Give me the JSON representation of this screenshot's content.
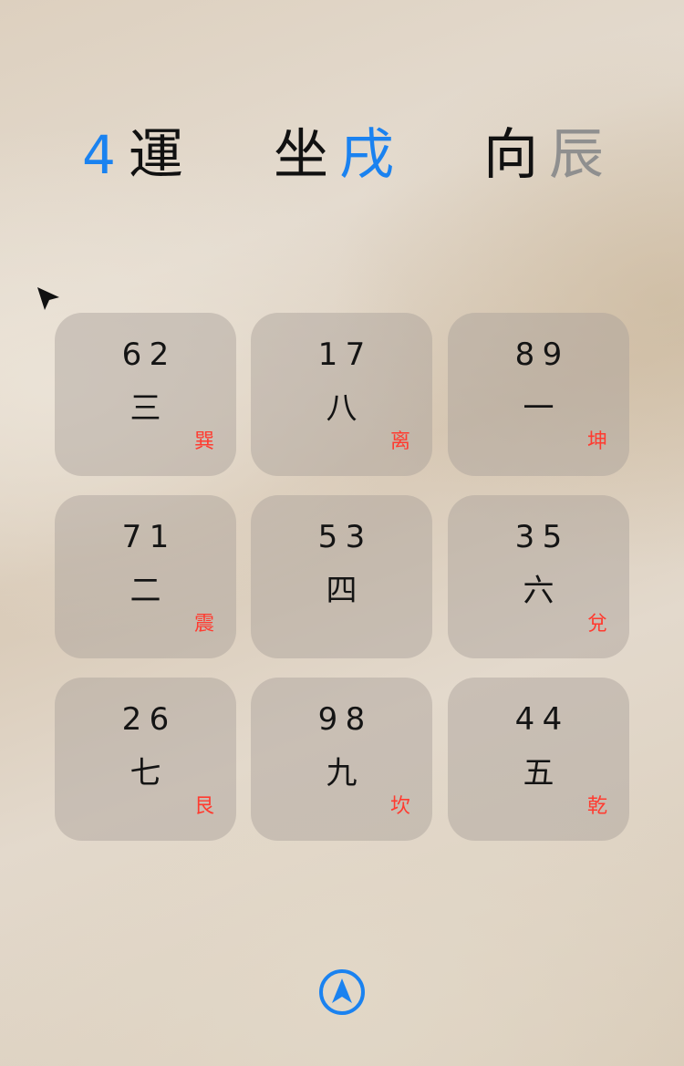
{
  "header": {
    "period_number": "4",
    "period_label": "運",
    "sitting_label": "坐",
    "sitting_value": "戌",
    "facing_label": "向",
    "facing_value": "辰"
  },
  "grid": {
    "cells": [
      {
        "mountain": "6",
        "water": "2",
        "base": "三",
        "trigram": "巽"
      },
      {
        "mountain": "1",
        "water": "7",
        "base": "八",
        "trigram": "离"
      },
      {
        "mountain": "8",
        "water": "9",
        "base": "一",
        "trigram": "坤"
      },
      {
        "mountain": "7",
        "water": "1",
        "base": "二",
        "trigram": "震"
      },
      {
        "mountain": "5",
        "water": "3",
        "base": "四",
        "trigram": ""
      },
      {
        "mountain": "3",
        "water": "5",
        "base": "六",
        "trigram": "兌"
      },
      {
        "mountain": "2",
        "water": "6",
        "base": "七",
        "trigram": "艮"
      },
      {
        "mountain": "9",
        "water": "8",
        "base": "九",
        "trigram": "坎"
      },
      {
        "mountain": "4",
        "water": "4",
        "base": "五",
        "trigram": "乾"
      }
    ]
  },
  "icons": {
    "cursor": "pointer-cursor-icon",
    "navigation": "navigation-arrow-icon"
  },
  "colors": {
    "accent_blue": "#1a82f0",
    "trigram_red": "#ff3b30",
    "facing_gray": "#8f8f8f"
  }
}
